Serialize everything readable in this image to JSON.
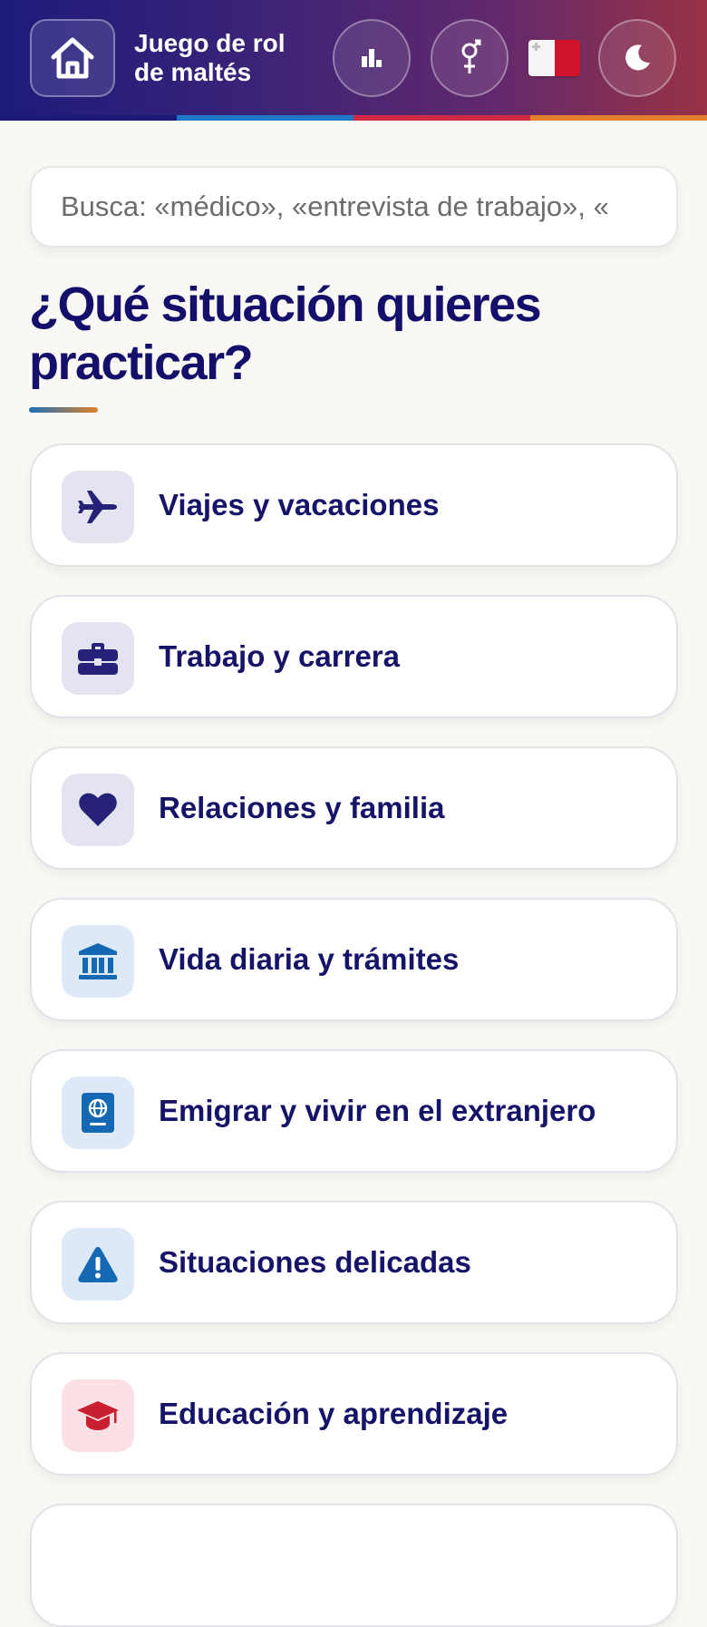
{
  "header": {
    "title_line1": "Juego de rol",
    "title_line2": "de maltés",
    "home_icon": "home-icon",
    "stats_icon": "bar-chart-icon",
    "gender_icon": "gender-symbol-icon",
    "flag_icon": "malta-flag-icon",
    "theme_icon": "moon-icon",
    "stripe_colors": [
      "#1c1a78",
      "#1e78c8",
      "#d12a45",
      "#e37f2c"
    ]
  },
  "search": {
    "placeholder": "Busca: «médico», «entrevista de trabajo», «"
  },
  "main": {
    "heading": "¿Qué situación quieres practicar?",
    "categories": [
      {
        "label": "Viajes y vacaciones",
        "icon": "airplane-icon",
        "icon_color": "#252277"
      },
      {
        "label": "Trabajo y carrera",
        "icon": "briefcase-icon",
        "icon_color": "#252277"
      },
      {
        "label": "Relaciones y familia",
        "icon": "heart-icon",
        "icon_color": "#252277"
      },
      {
        "label": "Vida diaria y trámites",
        "icon": "bank-building-icon",
        "icon_color": "#1568b3"
      },
      {
        "label": "Emigrar y vivir en el extranjero",
        "icon": "passport-icon",
        "icon_color": "#1568b3"
      },
      {
        "label": "Situaciones delicadas",
        "icon": "warning-icon",
        "icon_color": "#1568b3"
      },
      {
        "label": "Educación y aprendizaje",
        "icon": "graduation-cap-icon",
        "icon_color": "#c8202f"
      },
      {
        "label": "",
        "icon": "",
        "icon_color": ""
      }
    ]
  }
}
